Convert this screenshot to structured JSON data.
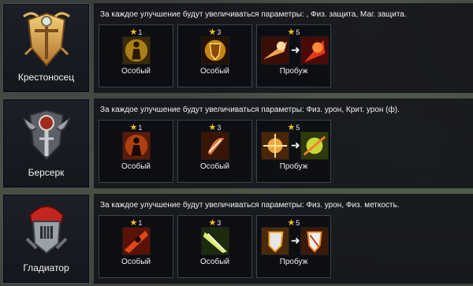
{
  "colors": {
    "star": "#f3c21b",
    "panel_bg": "#101218",
    "card_border": "#4a4f5c"
  },
  "rows": [
    {
      "class_name": "Крестоносец",
      "emblem_icon": "crusader-shield-emblem-icon",
      "description": "За каждое улучшение будут увеличиваться параметры: , Физ. защита, Маг. защита.",
      "skills": [
        {
          "stars": "1",
          "label": "Особый",
          "icon": "golden-aura-figure-icon"
        },
        {
          "stars": "3",
          "label": "Особый",
          "icon": "golden-shield-burst-icon"
        },
        {
          "stars": "5",
          "label": "Пробуж",
          "icon": "fire-charge-awaken-icon"
        }
      ]
    },
    {
      "class_name": "Берсерк",
      "emblem_icon": "berserker-axe-emblem-icon",
      "description": "За каждое улучшение будут увеличиваться параметры: Физ. урон, Крит. урон (ф).",
      "skills": [
        {
          "stars": "1",
          "label": "Особый",
          "icon": "rage-silhouette-icon"
        },
        {
          "stars": "3",
          "label": "Особый",
          "icon": "blade-slash-icon"
        },
        {
          "stars": "5",
          "label": "Пробуж",
          "icon": "explosive-strike-awaken-icon"
        }
      ]
    },
    {
      "class_name": "Гладиатор",
      "emblem_icon": "gladiator-helmet-emblem-icon",
      "description": "За каждое улучшение будут увеличиваться параметры: Физ. урон, Физ. меткость.",
      "skills": [
        {
          "stars": "1",
          "label": "Особый",
          "icon": "dash-strike-icon"
        },
        {
          "stars": "3",
          "label": "Особый",
          "icon": "light-beam-icon"
        },
        {
          "stars": "5",
          "label": "Пробуж",
          "icon": "shield-shatter-awaken-icon"
        }
      ]
    }
  ]
}
